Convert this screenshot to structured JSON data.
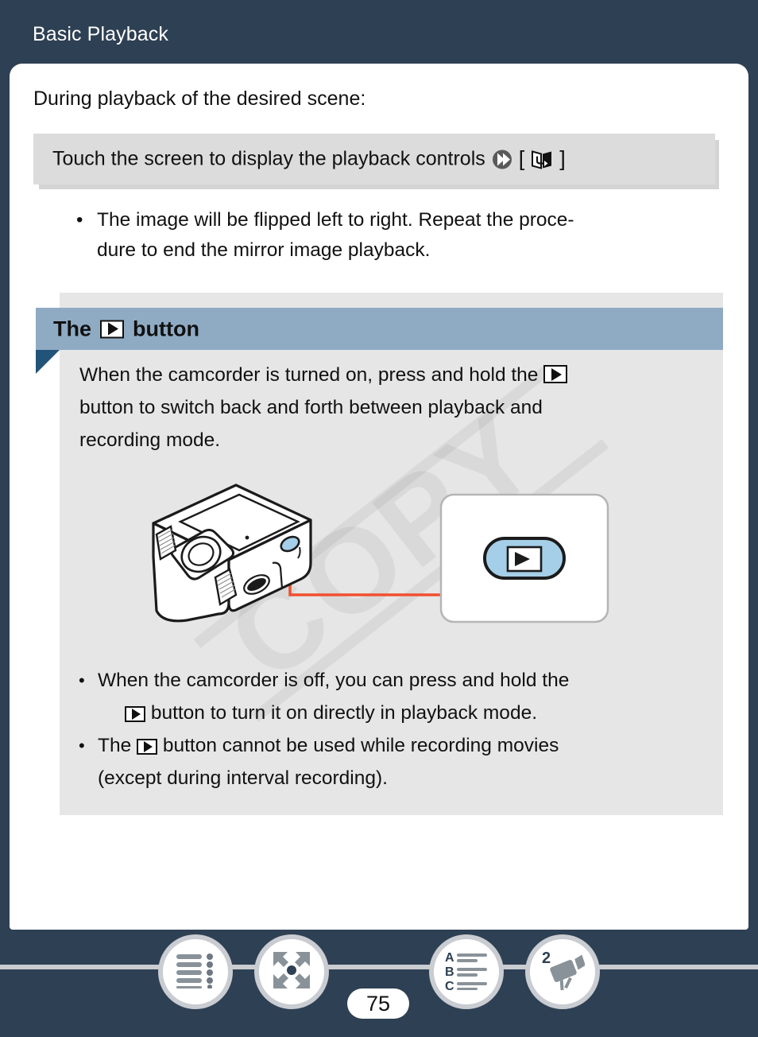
{
  "header": {
    "title": "Basic Playback"
  },
  "content": {
    "intro": "During playback of the desired scene:",
    "action": {
      "text": "Touch the screen to display the playback controls",
      "chevron_icon": "double-chevron-right-icon",
      "open_bracket": "[",
      "close_bracket": "]",
      "icon": "mirror-image-flip-icon"
    },
    "bullets": [
      "The image will be flipped left to right. Repeat the proce-",
      "dure to end the mirror image playback."
    ]
  },
  "section": {
    "title_prefix": "The",
    "title_icon": "play-button-icon",
    "title_suffix": "button",
    "body": {
      "line1_a": "When the camcorder is turned on, press and hold the",
      "line1_icon": "play-button-icon",
      "line2": "button to switch back and forth between playback and",
      "line3": "recording mode."
    },
    "illustration": {
      "device": "camcorder-line-drawing",
      "callout": "playback-button-closeup",
      "callout_button_icon": "play-button-icon",
      "leader_color": "#f1502f",
      "button_fill": "#a5cfe8"
    },
    "bullets": [
      {
        "line1": "When the camcorder is off, you can press and hold the",
        "icon": "play-button-icon",
        "line2": "button to turn it on directly in playback mode."
      },
      {
        "line1_a": "The",
        "icon": "play-button-icon",
        "line1_b": "button cannot be used while recording movies",
        "line2": "(except during interval recording)."
      }
    ]
  },
  "watermark": "COPY",
  "footer": {
    "page_number": "75",
    "nav": [
      {
        "name": "table-of-contents-icon",
        "label": "Table of contents"
      },
      {
        "name": "expand-arrows-icon",
        "label": "Quick reference"
      },
      {
        "name": "alphabetical-index-icon",
        "label": "Index"
      },
      {
        "name": "camcorder-icon",
        "label": "2",
        "badge": "2"
      }
    ]
  },
  "colors": {
    "background": "#2e4053",
    "page": "#ffffff",
    "section_bar": "#8fabc4",
    "section_tab": "#225378",
    "section_body": "#e6e6e6",
    "action_box": "#dcdcdc",
    "nav_ring": "#c9ccd1"
  }
}
